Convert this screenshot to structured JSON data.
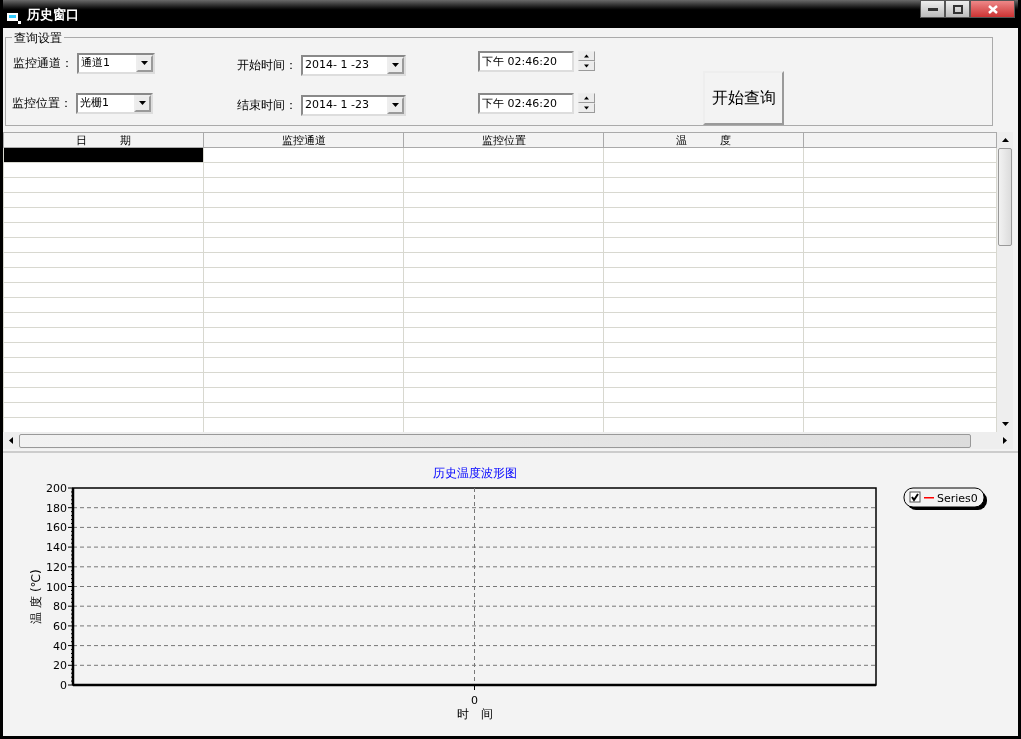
{
  "window": {
    "title": "历史窗口"
  },
  "query": {
    "title": "查询设置",
    "channel": {
      "label": "监控通道：",
      "value": "通道1"
    },
    "position": {
      "label": "监控位置：",
      "value": "光栅1"
    },
    "start": {
      "label": "开始时间：",
      "date": "2014- 1 -23",
      "time": "下午 02:46:20"
    },
    "end": {
      "label": "结束时间：",
      "date": "2014- 1 -23",
      "time": "下午 02:46:20"
    },
    "button": "开始查询"
  },
  "table": {
    "columns": [
      "日　　　期",
      "监控通道",
      "监控位置",
      "温　　　度"
    ],
    "rows": [
      {
        "selected": true
      },
      {
        "selected": false
      },
      {
        "selected": false
      },
      {
        "selected": false
      },
      {
        "selected": false
      },
      {
        "selected": false
      },
      {
        "selected": false
      },
      {
        "selected": false
      },
      {
        "selected": false
      },
      {
        "selected": false
      },
      {
        "selected": false
      },
      {
        "selected": false
      },
      {
        "selected": false
      },
      {
        "selected": false
      },
      {
        "selected": false
      },
      {
        "selected": false
      },
      {
        "selected": false
      },
      {
        "selected": false
      },
      {
        "selected": false
      }
    ]
  },
  "chart": {
    "title": "历史温度波形图",
    "xlabel": "时　间",
    "ylabel": "温 度 (℃)",
    "x_tick_labels": [
      "0"
    ],
    "y_tick_labels": [
      "200",
      "180",
      "160",
      "140",
      "120",
      "100",
      "80",
      "60",
      "40",
      "20",
      "0"
    ],
    "legend": [
      {
        "name": "Series0",
        "checked": true,
        "color": "#ff0000"
      }
    ]
  }
}
